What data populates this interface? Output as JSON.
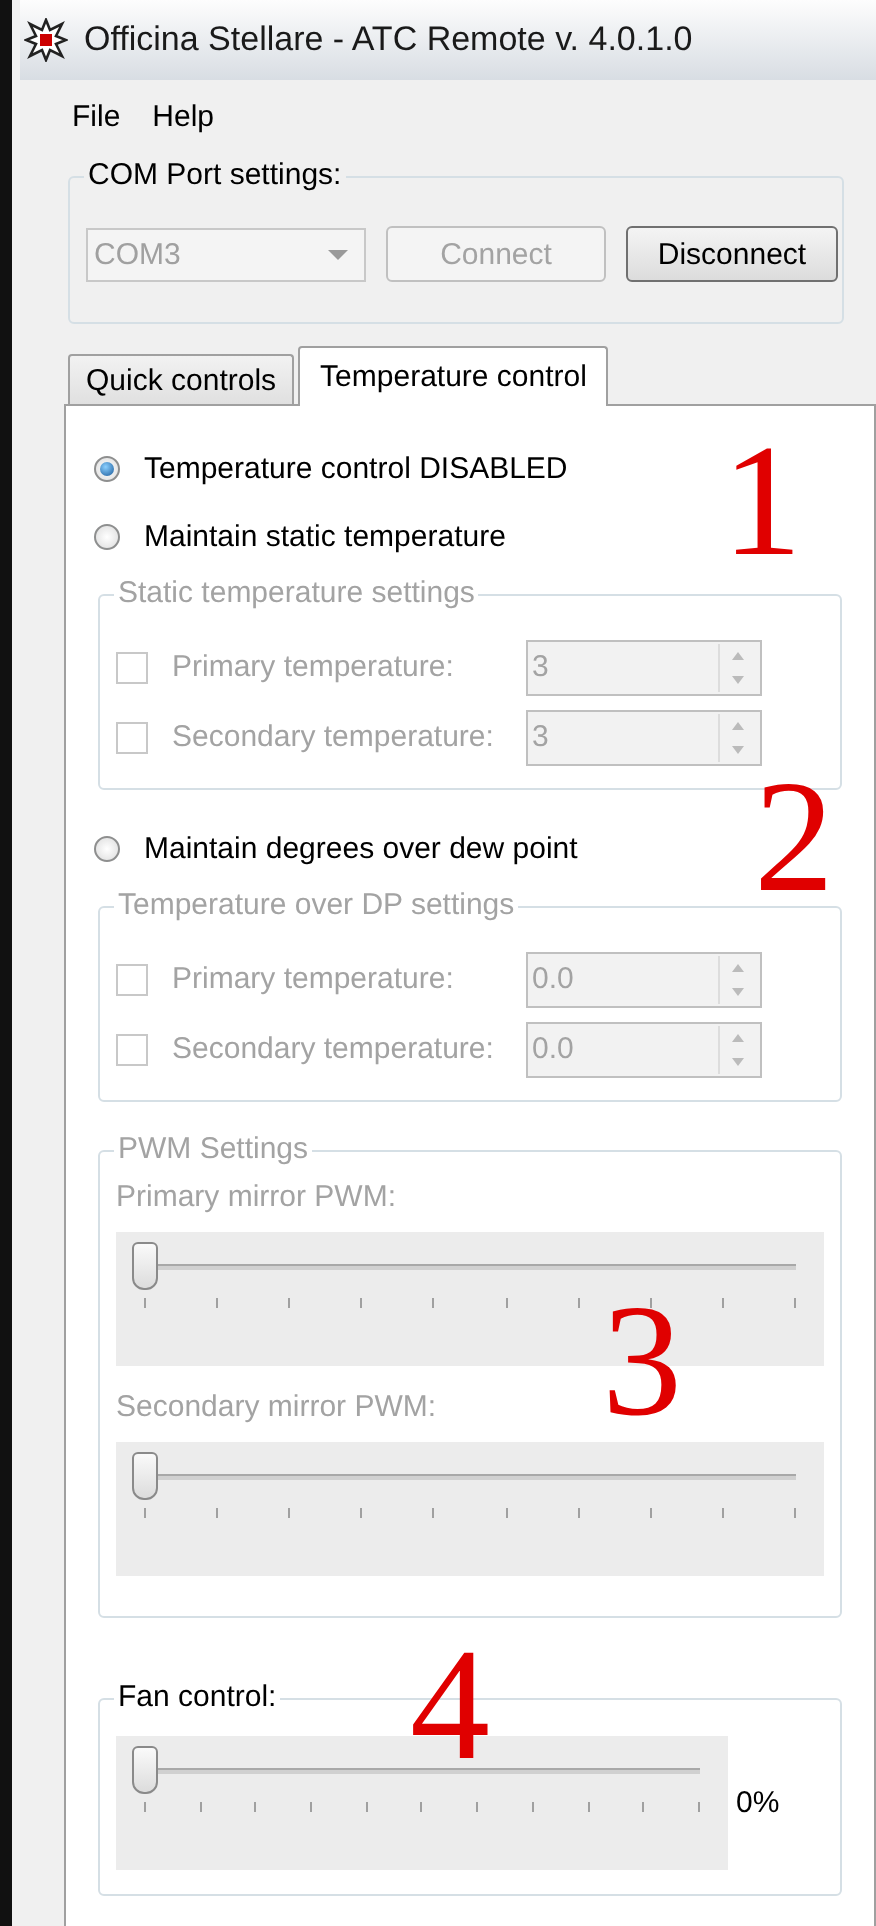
{
  "window": {
    "title": "Officina Stellare - ATC Remote v. 4.0.1.0"
  },
  "menu": [
    {
      "label": "File"
    },
    {
      "label": "Help"
    }
  ],
  "com_port": {
    "title": "COM Port settings:",
    "port": {
      "value": "COM3",
      "disabled": true
    },
    "buttons": [
      {
        "label": "Connect",
        "disabled": true
      },
      {
        "label": "Disconnect",
        "disabled": false
      }
    ]
  },
  "tabs": [
    {
      "label": "Quick controls",
      "selected": false
    },
    {
      "label": "Temperature control",
      "selected": true
    }
  ],
  "modes": [
    {
      "label": "Temperature control DISABLED",
      "selected": true
    },
    {
      "label": "Maintain static temperature",
      "selected": false,
      "settings": {
        "title": "Static temperature settings",
        "disabled": true,
        "rows": [
          {
            "label": "Primary temperature:",
            "checked": false,
            "value": "3"
          },
          {
            "label": "Secondary temperature:",
            "checked": false,
            "value": "3"
          }
        ]
      }
    },
    {
      "label": "Maintain degrees over dew point",
      "selected": false,
      "settings": {
        "title": "Temperature over DP settings",
        "disabled": true,
        "rows": [
          {
            "label": "Primary temperature:",
            "checked": false,
            "value": "0.0"
          },
          {
            "label": "Secondary temperature:",
            "checked": false,
            "value": "0.0"
          }
        ]
      }
    }
  ],
  "pwm": {
    "title": "PWM Settings",
    "disabled": true,
    "sliders": [
      {
        "label": "Primary mirror PWM:",
        "level": 0
      },
      {
        "label": "Secondary mirror PWM:",
        "level": 0
      }
    ]
  },
  "fan": {
    "title": "Fan control:",
    "disabled": false,
    "level": 0,
    "reading": "0%"
  },
  "annotations": [
    {
      "text": "1"
    },
    {
      "text": "2"
    },
    {
      "text": "3"
    },
    {
      "text": "4"
    }
  ]
}
